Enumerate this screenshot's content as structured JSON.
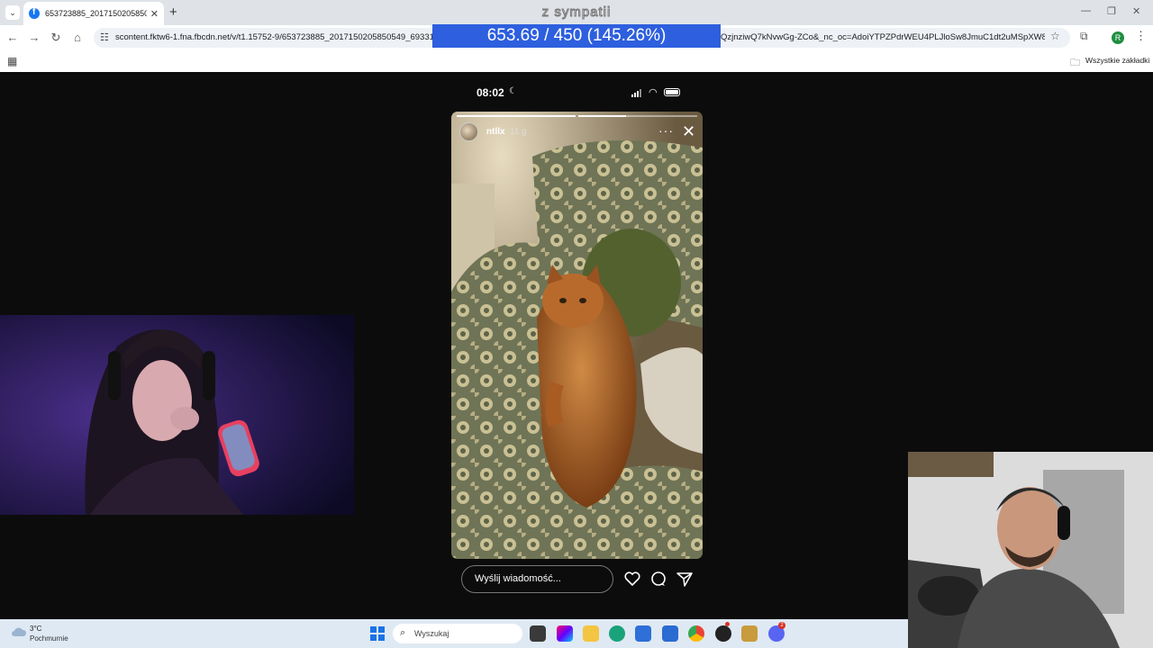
{
  "browser": {
    "tab_title": "653723885_201715020585054…",
    "new_tab": "+",
    "url_start": "scontent.fktw6-1.fna.fbcdn.net/v/t1.15752-9/653723885_201715020585054​9_6933119",
    "url_end": "QzjnziwQ7kNvwGg-ZCo&_nc_oc=AdoiYTPZPdrWEU4PLJloSw8JmuC1dt2uMSpXW8Jp...",
    "profile_initial": "R",
    "bookmarks_label": "Wszystkie zakładki"
  },
  "overlay": {
    "label": "z sympatii",
    "counter": "653.69 / 450 (145.26%)"
  },
  "phone": {
    "time": "08:02",
    "battery_level": 1.0
  },
  "story": {
    "username": "ntllx",
    "age": "11 g",
    "progress": [
      1.0,
      0.4
    ],
    "reply_placeholder": "Wyślij wiadomość..."
  },
  "taskbar": {
    "temperature": "3°C",
    "condition": "Pochmurnie",
    "search_label": "Wyszukaj",
    "chrome_badge": "",
    "discord_badge": "2"
  },
  "colors": {
    "overlay_bar": "#2d5fde",
    "page_background": "#0c0c0c",
    "taskbar": "#dfe9f3"
  }
}
